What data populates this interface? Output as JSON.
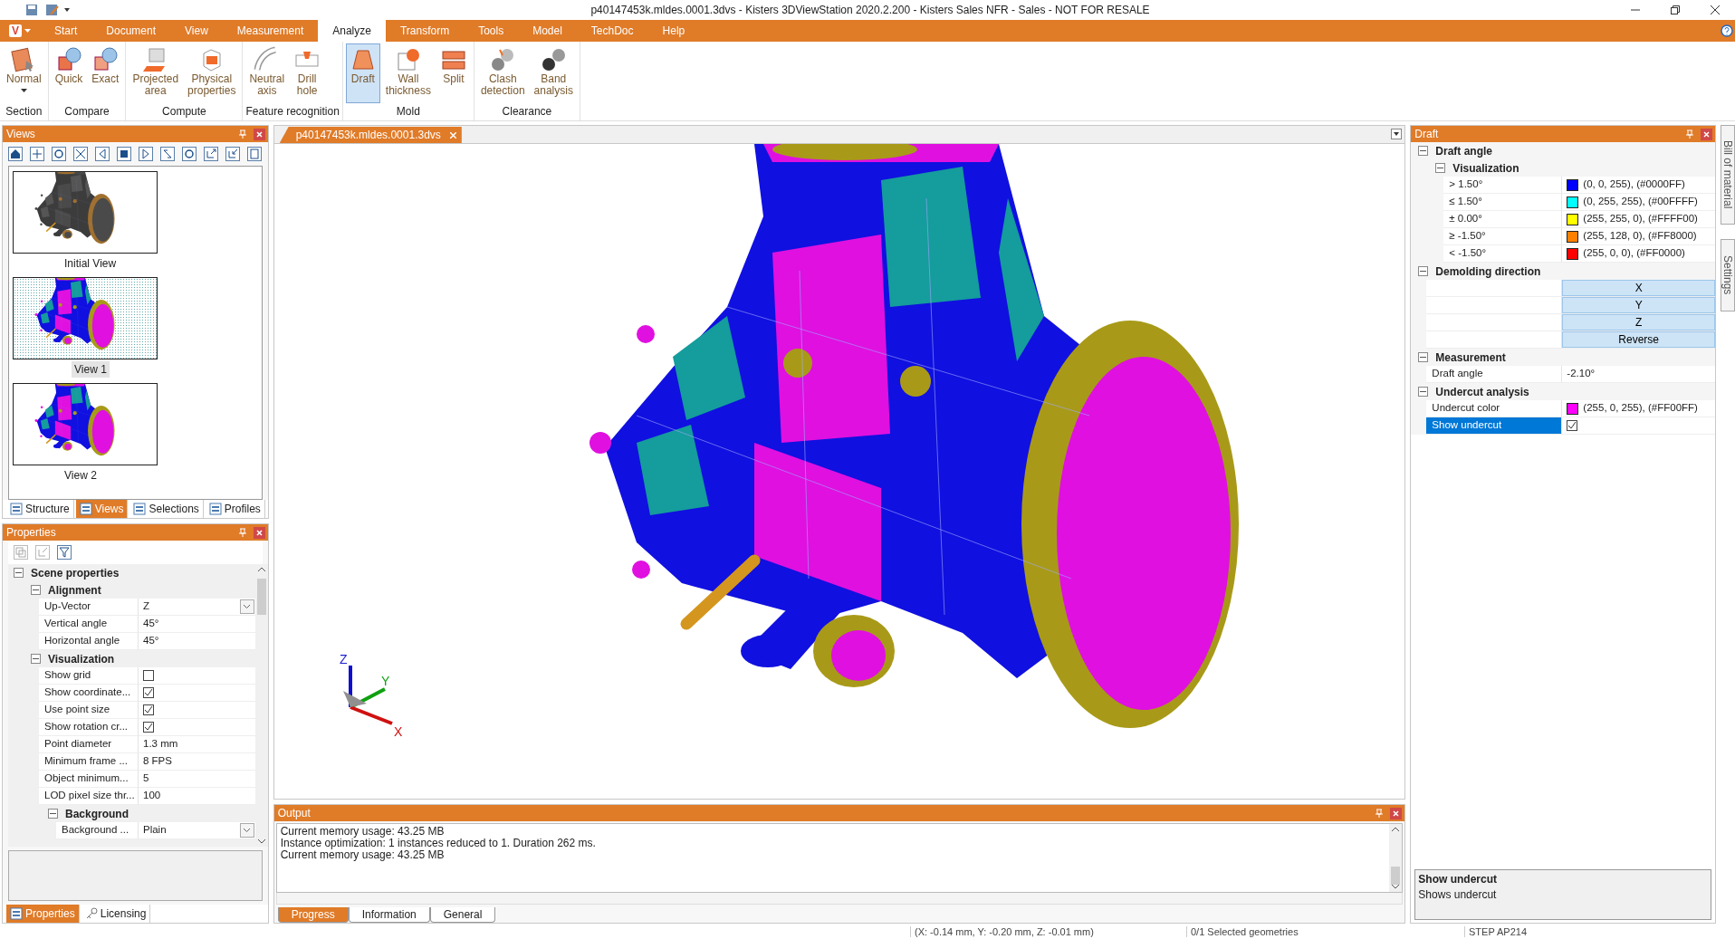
{
  "window": {
    "title": "p40147453k.mldes.0001.3dvs - Kisters 3DViewStation 2020.2.200 - Kisters Sales NFR - Sales - NOT FOR RESALE"
  },
  "app_button": {
    "label": "V"
  },
  "menu_tabs": [
    {
      "label": "Start",
      "selected": false
    },
    {
      "label": "Document",
      "selected": false
    },
    {
      "label": "View",
      "selected": false
    },
    {
      "label": "Measurement",
      "selected": false
    },
    {
      "label": "Analyze",
      "selected": true
    },
    {
      "label": "Transform",
      "selected": false
    },
    {
      "label": "Tools",
      "selected": false
    },
    {
      "label": "Model",
      "selected": false
    },
    {
      "label": "TechDoc",
      "selected": false
    },
    {
      "label": "Help",
      "selected": false
    }
  ],
  "ribbon": {
    "groups": [
      {
        "label": "Section",
        "tools": [
          {
            "label": "Normal",
            "has_menu": true,
            "selected": false
          }
        ]
      },
      {
        "label": "Compare",
        "tools": [
          {
            "label": "Quick",
            "has_menu": false,
            "selected": false
          },
          {
            "label": "Exact",
            "has_menu": false,
            "selected": false
          }
        ]
      },
      {
        "label": "Compute",
        "tools": [
          {
            "label": "Projected\narea",
            "has_menu": false,
            "selected": false
          },
          {
            "label": "Physical\nproperties",
            "has_menu": false,
            "selected": false
          }
        ]
      },
      {
        "label": "Feature recognition",
        "tools": [
          {
            "label": "Neutral\naxis",
            "has_menu": false,
            "selected": false
          },
          {
            "label": "Drill\nhole",
            "has_menu": false,
            "selected": false
          }
        ]
      },
      {
        "label": "Mold",
        "tools": [
          {
            "label": "Draft",
            "has_menu": false,
            "selected": true
          },
          {
            "label": "Wall\nthickness",
            "has_menu": false,
            "selected": false
          },
          {
            "label": "Split",
            "has_menu": false,
            "selected": false
          }
        ]
      },
      {
        "label": "Clearance",
        "tools": [
          {
            "label": "Clash\ndetection",
            "has_menu": false,
            "selected": false
          },
          {
            "label": "Band\nanalysis",
            "has_menu": false,
            "selected": false
          }
        ]
      }
    ]
  },
  "views_panel": {
    "title": "Views",
    "thumbnails": [
      {
        "label": "Initial View",
        "selected": false
      },
      {
        "label": "View 1",
        "selected": true
      },
      {
        "label": "View 2",
        "selected": false
      }
    ],
    "tabs": [
      {
        "label": "Structure",
        "selected": false
      },
      {
        "label": "Views",
        "selected": true
      },
      {
        "label": "Selections",
        "selected": false
      },
      {
        "label": "Profiles",
        "selected": false
      }
    ]
  },
  "properties_panel": {
    "title": "Properties",
    "tree": [
      {
        "kind": "group",
        "label": "Scene properties",
        "expanded": true,
        "children": [
          {
            "kind": "group",
            "label": "Alignment",
            "expanded": true,
            "children": [
              {
                "kind": "dropdown",
                "label": "Up-Vector",
                "value": "Z"
              },
              {
                "kind": "text",
                "label": "Vertical angle",
                "value": "45°"
              },
              {
                "kind": "text",
                "label": "Horizontal angle",
                "value": "45°"
              }
            ]
          },
          {
            "kind": "group",
            "label": "Visualization",
            "expanded": true,
            "children": [
              {
                "kind": "checkbox",
                "label": "Show grid",
                "checked": false
              },
              {
                "kind": "checkbox",
                "label": "Show coordinate...",
                "checked": true
              },
              {
                "kind": "checkbox",
                "label": "Use point size",
                "checked": true
              },
              {
                "kind": "checkbox",
                "label": "Show rotation cr...",
                "checked": true
              },
              {
                "kind": "text",
                "label": "Point diameter",
                "value": "1.3 mm"
              },
              {
                "kind": "text",
                "label": "Minimum frame ...",
                "value": "8 FPS"
              },
              {
                "kind": "text",
                "label": "Object minimum...",
                "value": "5"
              },
              {
                "kind": "text",
                "label": "LOD pixel size thr...",
                "value": "100"
              },
              {
                "kind": "group",
                "label": "Background",
                "expanded": true,
                "children": [
                  {
                    "kind": "dropdown",
                    "label": "Background ...",
                    "value": "Plain"
                  }
                ]
              }
            ]
          }
        ]
      }
    ],
    "tabs": [
      {
        "label": "Properties",
        "selected": true
      },
      {
        "label": "Licensing",
        "selected": false
      }
    ]
  },
  "document_tab": {
    "label": "p40147453k.mldes.0001.3dvs"
  },
  "viewport": {
    "axes": {
      "x": "X",
      "y": "Y",
      "z": "Z"
    }
  },
  "output": {
    "title": "Output",
    "lines": [
      "Current memory usage: 43.25 MB",
      "Instance optimization: 1 instances reduced to 1. Duration 262 ms.",
      "Current memory usage: 43.25 MB"
    ],
    "tabs": [
      {
        "label": "Progress",
        "selected": true
      },
      {
        "label": "Information",
        "selected": false
      },
      {
        "label": "General",
        "selected": false
      }
    ]
  },
  "draft_panel": {
    "title": "Draft",
    "tree": [
      {
        "kind": "group",
        "label": "Draft angle",
        "expanded": true,
        "children": [
          {
            "kind": "group",
            "label": "Visualization",
            "expanded": true,
            "children": [
              {
                "kind": "color",
                "label": "> 1.50°",
                "color": "#0000ff",
                "value": "(0, 0, 255), (#0000FF)",
                "selected": false
              },
              {
                "kind": "color",
                "label": "≤ 1.50°",
                "color": "#00ffff",
                "value": "(0, 255, 255), (#00FFFF)",
                "selected": false
              },
              {
                "kind": "color",
                "label": "± 0.00°",
                "color": "#ffff00",
                "value": "(255, 255, 0), (#FFFF00)",
                "selected": false
              },
              {
                "kind": "color",
                "label": "≥ -1.50°",
                "color": "#ff8000",
                "value": "(255, 128, 0), (#FF8000)",
                "selected": false
              },
              {
                "kind": "color",
                "label": "< -1.50°",
                "color": "#ff0000",
                "value": "(255, 0, 0), (#FF0000)",
                "selected": false
              }
            ]
          }
        ]
      },
      {
        "kind": "group",
        "label": "Demolding direction",
        "expanded": true,
        "children": [
          {
            "kind": "button",
            "label": "X",
            "selected": false
          },
          {
            "kind": "button",
            "label": "Y",
            "selected": false
          },
          {
            "kind": "button",
            "label": "Z",
            "selected": false
          },
          {
            "kind": "button",
            "label": "Reverse",
            "selected": false
          }
        ]
      },
      {
        "kind": "group",
        "label": "Measurement",
        "expanded": true,
        "children": [
          {
            "kind": "text",
            "label": "Draft angle",
            "value": "-2.10°",
            "selected": false
          }
        ]
      },
      {
        "kind": "group",
        "label": "Undercut analysis",
        "expanded": true,
        "children": [
          {
            "kind": "color",
            "label": "Undercut color",
            "color": "#ff00ff",
            "value": "(255, 0, 255), (#FF00FF)",
            "selected": false
          },
          {
            "kind": "checkbox",
            "label": "Show undercut",
            "checked": true,
            "selected": true
          }
        ]
      }
    ]
  },
  "info_box": {
    "title": "Show undercut",
    "text": "Shows undercut"
  },
  "side_tabs": [
    {
      "label": "Bill of material"
    },
    {
      "label": "Settings"
    }
  ],
  "status_bar": {
    "coordinates": "(X: -0.14 mm, Y: -0.20 mm, Z: -0.01 mm)",
    "selection": "0/1 Selected geometries",
    "format": "STEP AP214"
  }
}
